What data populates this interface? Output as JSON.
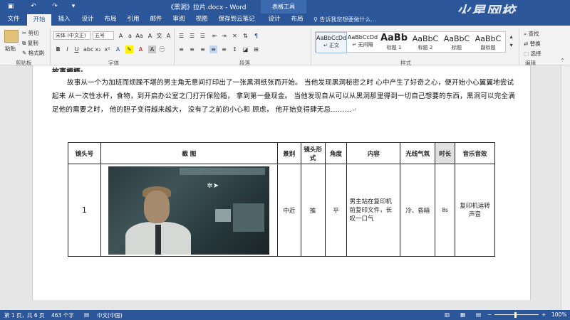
{
  "window": {
    "title": "《黑洞》拉片.docx - Word",
    "context_tool": "表格工具",
    "brand_watermark": "火星网校"
  },
  "tabs": [
    "文件",
    "开始",
    "插入",
    "设计",
    "布局",
    "引用",
    "邮件",
    "审阅",
    "视图",
    "保存到云笔记",
    "设计",
    "布局"
  ],
  "tell_me": "告诉我您想要做什么...",
  "ribbon": {
    "clipboard": {
      "paste": "粘贴",
      "cut": "剪切",
      "copy": "复制",
      "format_painter": "格式刷",
      "label": "剪贴板"
    },
    "font": {
      "name": "宋体 (中文正)",
      "size": "五号",
      "label": "字体"
    },
    "paragraph": {
      "label": "段落"
    },
    "styles": {
      "label": "样式",
      "items": [
        {
          "sample": "AaBbCcDd",
          "name": "↵ 正文"
        },
        {
          "sample": "AaBbCcDd",
          "name": "↵ 无间隔"
        },
        {
          "sample": "AaBb",
          "name": "标题 1"
        },
        {
          "sample": "AaBbC",
          "name": "标题 2"
        },
        {
          "sample": "AaBbC",
          "name": "标题"
        },
        {
          "sample": "AaBbC",
          "name": "副标题"
        }
      ]
    },
    "editing": {
      "find": "查找",
      "replace": "替换",
      "select": "选择",
      "label": "编辑"
    }
  },
  "document": {
    "heading": "故事梗概:",
    "paragraph": "故事从一个为加班而烦躁不堪的男主角无意间打印出了一张黑洞纸张而开始。 当他发现黑洞秘密之时 心中产生了好奇之心，便开始小心翼翼地尝试起来 从一次性水杯，食物，到开启办公室之门打开保险箱， 拿到第一叠现金。 当他发现自从可以从黑洞那里得到一切自己想要的东西，黑洞可以完全满足他的需要之时， 他的胆子变得越来越大， 没有了之前的小心和 顾虑， 他开始变得肆无忌………",
    "table": {
      "headers": [
        "镜头号",
        "截 图",
        "景别",
        "镜头形式",
        "角度",
        "内容",
        "光线气氛",
        "时长",
        "音乐音效"
      ],
      "rows": [
        {
          "shot_no": "1",
          "scale": "中近",
          "movement": "推",
          "angle": "平",
          "content": "男主站在复印机前复印文件，长叹一口气",
          "lighting": "冷、昏暗",
          "duration": "8s",
          "sound": "复印机运转声音"
        }
      ]
    }
  },
  "statusbar": {
    "page": "第 1 页，共 6 页",
    "words": "463 个字",
    "language": "中文(中国)",
    "zoom": "100%"
  }
}
